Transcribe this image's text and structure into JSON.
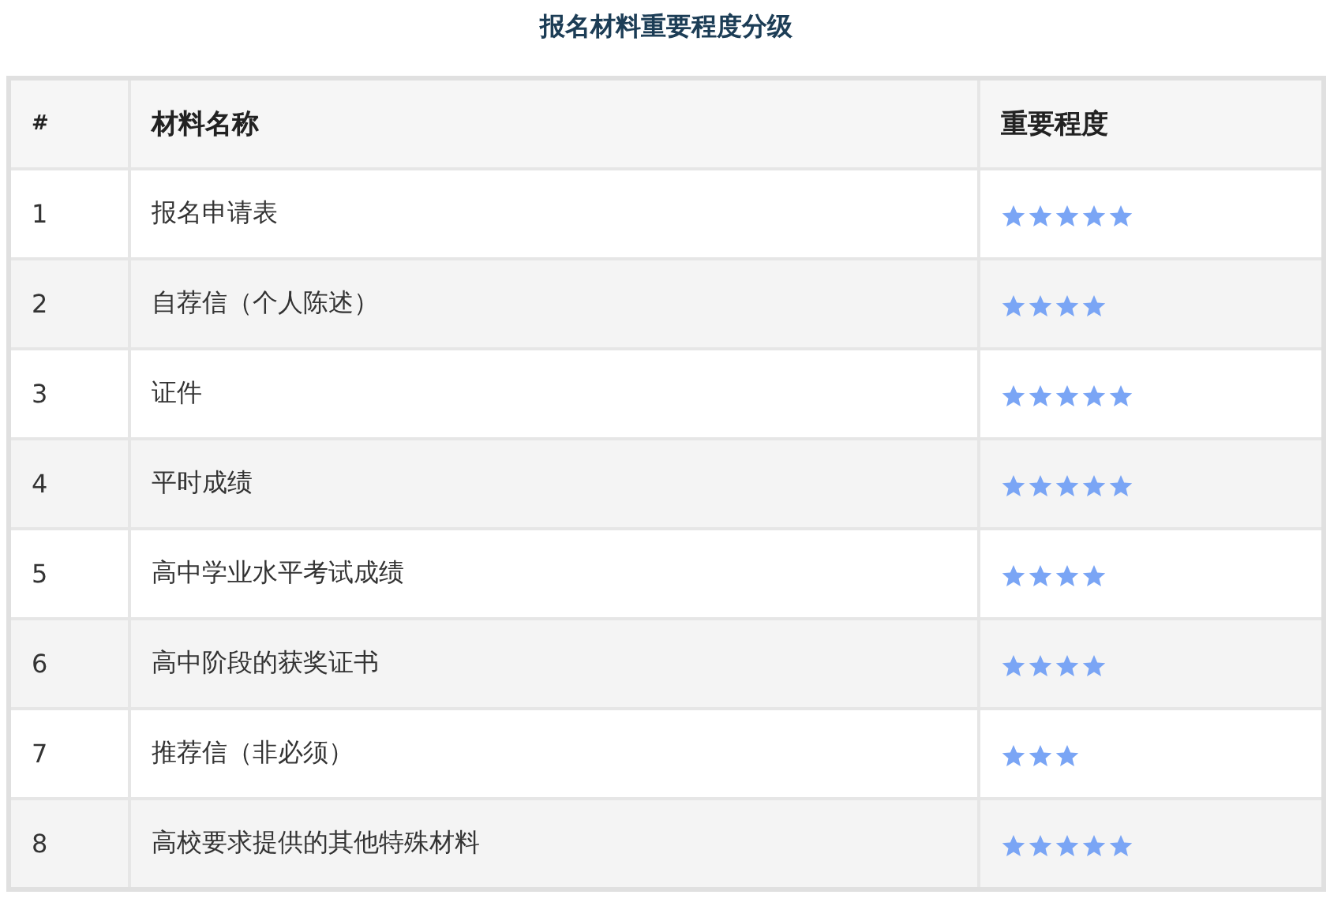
{
  "title": "报名材料重要程度分级",
  "table": {
    "columns": [
      "#",
      "材料名称",
      "重要程度"
    ],
    "rows": [
      {
        "index": "1",
        "name": "报名申请表",
        "stars": 5
      },
      {
        "index": "2",
        "name": "自荐信（个人陈述）",
        "stars": 4
      },
      {
        "index": "3",
        "name": "证件",
        "stars": 5
      },
      {
        "index": "4",
        "name": "平时成绩",
        "stars": 5
      },
      {
        "index": "5",
        "name": "高中学业水平考试成绩",
        "stars": 4
      },
      {
        "index": "6",
        "name": "高中阶段的获奖证书",
        "stars": 4
      },
      {
        "index": "7",
        "name": "推荐信（非必须）",
        "stars": 3
      },
      {
        "index": "8",
        "name": "高校要求提供的其他特殊材料",
        "stars": 5
      }
    ]
  }
}
